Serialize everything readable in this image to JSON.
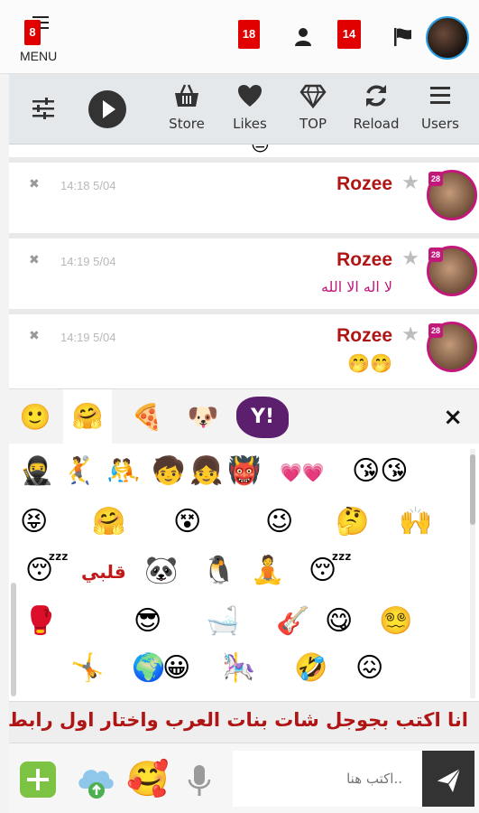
{
  "topbar": {
    "menu_label": "MENU",
    "menu_badge": "8",
    "messages_badge": "18",
    "notifications_badge": "14",
    "user_icon": "user-icon",
    "flag_icon": "flag-icon"
  },
  "toolbar": {
    "items": [
      {
        "label": "Store",
        "icon": "basket-icon"
      },
      {
        "label": "Likes",
        "icon": "heart-icon"
      },
      {
        "label": "TOP",
        "icon": "diamond-icon"
      },
      {
        "label": "Reload",
        "icon": "reload-icon"
      },
      {
        "label": "Users",
        "icon": "menu-icon"
      }
    ]
  },
  "messages": [
    {
      "name": "Rozee",
      "time": "14:18 5/04",
      "level": "28",
      "text": "",
      "emoji": "😶"
    },
    {
      "name": "Rozee",
      "time": "14:19 5/04",
      "level": "28",
      "text": "لا اله الا الله",
      "emoji": ""
    },
    {
      "name": "Rozee",
      "time": "14:19 5/04",
      "level": "28",
      "text": "",
      "emoji": "🤭🤭"
    }
  ],
  "emoji_panel": {
    "tabs": [
      "🙂",
      "🤗",
      "🍕",
      "🐶",
      "Y!"
    ],
    "close": "×",
    "grid": [
      [
        "🥷",
        "🤾",
        "🤼",
        "🧒",
        "👧",
        "👹",
        "💗💗",
        "😘😘"
      ],
      [
        "😝",
        "🤗",
        "😵",
        "😉",
        "🤔",
        "🙌"
      ],
      [
        "😴",
        "قلبي",
        "🐼",
        "🐧",
        "🧘",
        "😴"
      ],
      [
        "🥊",
        "😎",
        "🛁",
        "🎸",
        "😋",
        "😵‍💫"
      ],
      [
        "🤸",
        "🌍",
        "😀",
        "🎠",
        "🤣",
        "😖"
      ]
    ]
  },
  "banner": {
    "text": "انا اكتب بجوجل شات بنات العرب واختار اول رابط"
  },
  "input": {
    "placeholder": "اكتب هنا..",
    "emoji_button": "🥰"
  }
}
